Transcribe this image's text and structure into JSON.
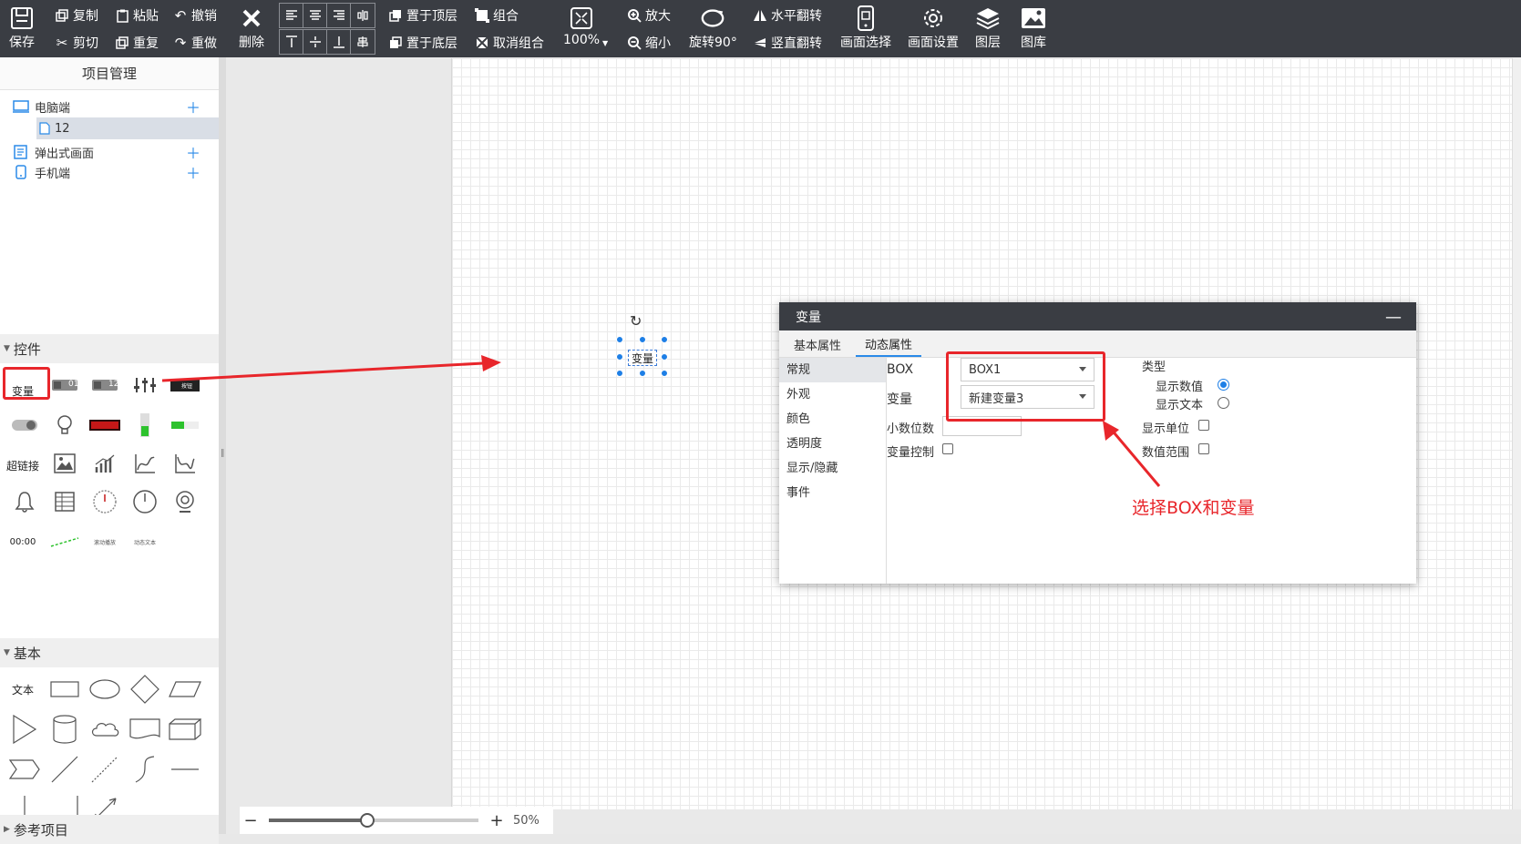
{
  "toolbar": {
    "save": "保存",
    "copy": "复制",
    "paste": "粘贴",
    "undo": "撤销",
    "cut": "剪切",
    "repeat": "重复",
    "redo": "重做",
    "delete": "删除",
    "bring_top": "置于顶层",
    "send_bottom": "置于底层",
    "group": "组合",
    "ungroup": "取消组合",
    "zoom_value": "100%",
    "zoom_in": "放大",
    "zoom_out": "缩小",
    "rotate": "旋转90°",
    "flip_h": "水平翻转",
    "flip_v": "竖直翻转",
    "screen_select": "画面选择",
    "screen_settings": "画面设置",
    "layers": "图层",
    "gallery": "图库"
  },
  "left_panel": {
    "title": "项目管理",
    "tree": [
      {
        "label": "电脑端",
        "icon": "monitor-icon",
        "has_add": true
      },
      {
        "label": "12",
        "icon": "page-icon",
        "has_add": false,
        "selected": true
      },
      {
        "label": "弹出式画面",
        "icon": "popup-icon",
        "has_add": true
      },
      {
        "label": "手机端",
        "icon": "phone-icon",
        "has_add": true
      }
    ],
    "sections": {
      "controls": "控件",
      "basic": "基本",
      "reference": "参考项目"
    },
    "control_items": {
      "variable": "变量",
      "hyperlink": "超链接",
      "time": "00:00",
      "num_label": "01",
      "num_label2": "12",
      "small_a": "按钮",
      "small_b": "滚动播放",
      "small_c": "动态文本"
    },
    "basic_items": {
      "text": "文本"
    }
  },
  "canvas": {
    "widget_label": "变量",
    "zoom_percent": "50%",
    "zoom_fraction": 0.47
  },
  "dialog": {
    "title": "变量",
    "tabs": [
      "基本属性",
      "动态属性"
    ],
    "active_tab": 1,
    "side_items": [
      "常规",
      "外观",
      "颜色",
      "透明度",
      "显示/隐藏",
      "事件"
    ],
    "active_side": 0,
    "box_label": "BOX",
    "box_value": "BOX1",
    "var_label": "变量",
    "var_value": "新建变量3",
    "decimal_label": "小数位数",
    "var_control_label": "变量控制",
    "type_label": "类型",
    "show_value_label": "显示数值",
    "show_text_label": "显示文本",
    "show_unit_label": "显示单位",
    "value_range_label": "数值范围"
  },
  "annotation": {
    "text": "选择BOX和变量",
    "color": "#e8262b"
  }
}
